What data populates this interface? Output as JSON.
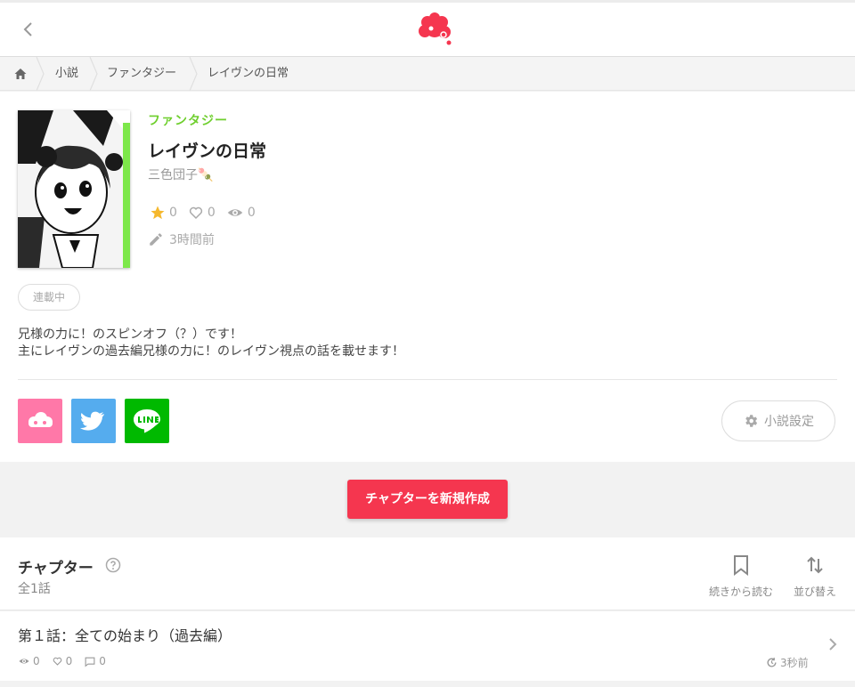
{
  "breadcrumb": {
    "items": [
      "小説",
      "ファンタジー",
      "レイヴンの日常"
    ]
  },
  "novel": {
    "genre": "ファンタジー",
    "title": "レイヴンの日常",
    "author": "三色団子🍡",
    "stars": "0",
    "likes": "0",
    "views": "0",
    "updated": "3時間前",
    "status": "連載中",
    "description_line1": "兄様の力に！のスピンオフ（？）です！",
    "description_line2": "主にレイヴンの過去編兄様の力に！のレイヴン視点の話を載せます！"
  },
  "settings_label": "小説設定",
  "create_chapter_label": "チャプターを新規作成",
  "chapters_section": {
    "title": "チャプター",
    "count": "全1話",
    "continue_label": "続きから読む",
    "sort_label": "並び替え"
  },
  "chapters": [
    {
      "title": "第１話：全ての始まり（過去編）",
      "views": "0",
      "likes": "0",
      "comments": "0",
      "time": "3秒前"
    }
  ],
  "colors": {
    "accent_red": "#f5364f",
    "genre_green": "#6fcf2e",
    "share_pink": "#ff78a8",
    "share_twitter": "#55acee",
    "share_line": "#00b900",
    "star": "#f5b82e"
  },
  "icons": [
    "back-chevron-icon",
    "logo-icon",
    "home-icon",
    "star-icon",
    "heart-icon",
    "eye-icon",
    "pencil-icon",
    "gear-icon",
    "help-icon",
    "bookmark-icon",
    "sort-icon",
    "comment-icon",
    "clock-icon",
    "chevron-right-icon"
  ]
}
